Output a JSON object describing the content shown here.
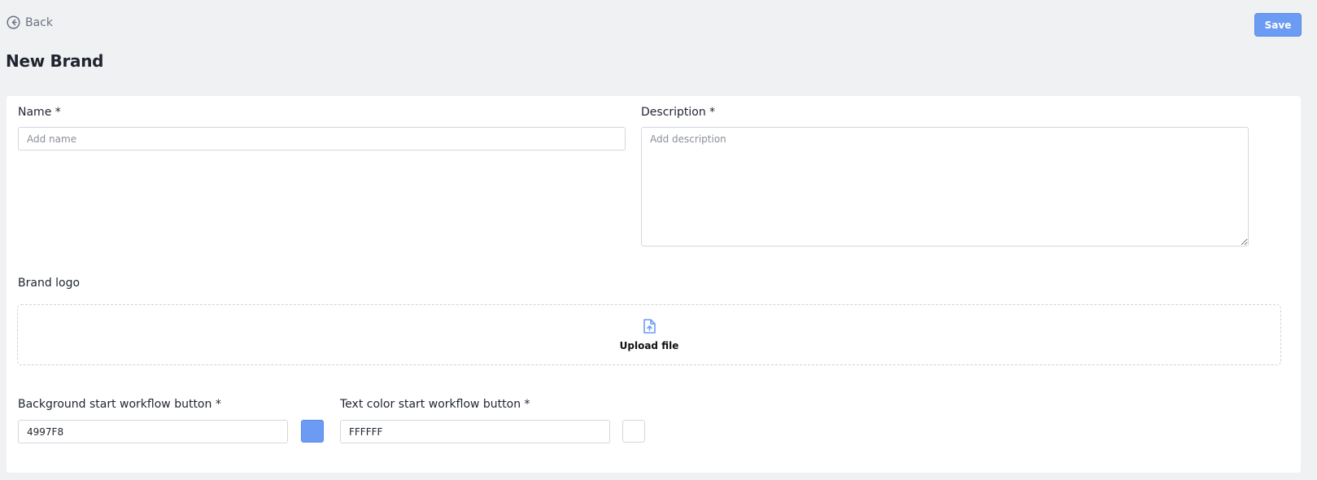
{
  "header": {
    "back_label": "Back",
    "save_label": "Save",
    "title": "New Brand"
  },
  "form": {
    "name": {
      "label": "Name *",
      "placeholder": "Add name",
      "value": ""
    },
    "description": {
      "label": "Description *",
      "placeholder": "Add description",
      "value": ""
    },
    "brand_logo": {
      "label": "Brand logo",
      "upload_label": "Upload file",
      "icon": "upload-file-icon"
    },
    "bg_color": {
      "label": "Background start workflow button *",
      "value": "4997F8",
      "swatch": "#6b9bf3"
    },
    "text_color": {
      "label": "Text color start workflow button *",
      "value": "FFFFFF",
      "swatch": "#ffffff"
    }
  },
  "colors": {
    "accent": "#6b9bf3",
    "page_bg": "#f0f1f3"
  }
}
